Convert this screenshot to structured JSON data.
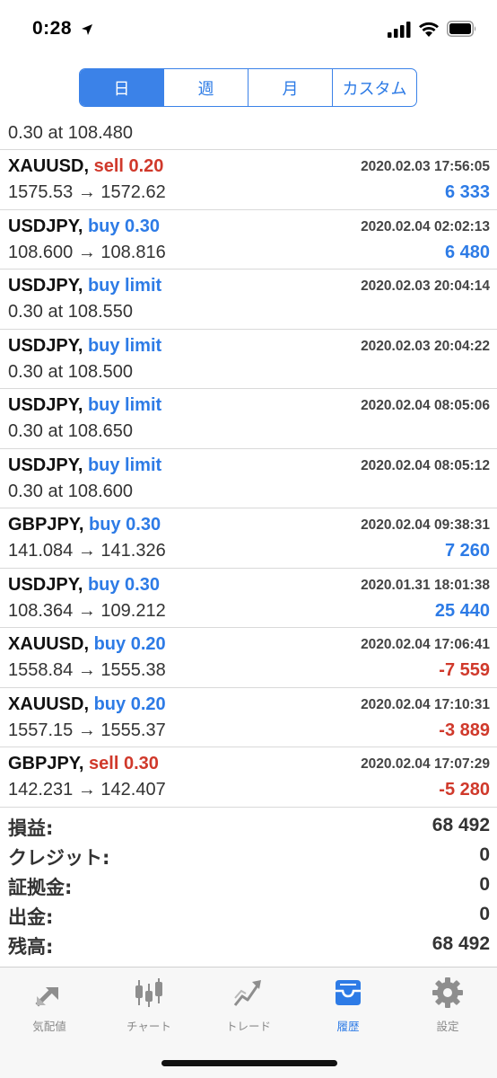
{
  "status": {
    "time": "0:28"
  },
  "segments": [
    "日",
    "週",
    "月",
    "カスタム"
  ],
  "partial_row": {
    "line2": "0.30 at 108.480"
  },
  "rows": [
    {
      "symbol": "XAUUSD,",
      "side": "sell 0.20",
      "date": "2020.02.03 17:56:05",
      "line2": "1575.53 → 1572.62",
      "profit": "6 333"
    },
    {
      "symbol": "USDJPY,",
      "side": "buy 0.30",
      "date": "2020.02.04 02:02:13",
      "line2": "108.600 → 108.816",
      "profit": "6 480"
    },
    {
      "symbol": "USDJPY,",
      "side": "buy limit",
      "date": "2020.02.03 20:04:14",
      "line2": "0.30 at 108.550",
      "profit": ""
    },
    {
      "symbol": "USDJPY,",
      "side": "buy limit",
      "date": "2020.02.03 20:04:22",
      "line2": "0.30 at 108.500",
      "profit": ""
    },
    {
      "symbol": "USDJPY,",
      "side": "buy limit",
      "date": "2020.02.04 08:05:06",
      "line2": "0.30 at 108.650",
      "profit": ""
    },
    {
      "symbol": "USDJPY,",
      "side": "buy limit",
      "date": "2020.02.04 08:05:12",
      "line2": "0.30 at 108.600",
      "profit": ""
    },
    {
      "symbol": "GBPJPY,",
      "side": "buy 0.30",
      "date": "2020.02.04 09:38:31",
      "line2": "141.084 → 141.326",
      "profit": "7 260"
    },
    {
      "symbol": "USDJPY,",
      "side": "buy 0.30",
      "date": "2020.01.31 18:01:38",
      "line2": "108.364 → 109.212",
      "profit": "25 440"
    },
    {
      "symbol": "XAUUSD,",
      "side": "buy 0.20",
      "date": "2020.02.04 17:06:41",
      "line2": "1558.84 → 1555.38",
      "profit": "-7 559"
    },
    {
      "symbol": "XAUUSD,",
      "side": "buy 0.20",
      "date": "2020.02.04 17:10:31",
      "line2": "1557.15 → 1555.37",
      "profit": "-3 889"
    },
    {
      "symbol": "GBPJPY,",
      "side": "sell 0.30",
      "date": "2020.02.04 17:07:29",
      "line2": "142.231 → 142.407",
      "profit": "-5 280"
    }
  ],
  "summary": [
    {
      "label": "損益:",
      "value": "68 492"
    },
    {
      "label": "クレジット:",
      "value": "0"
    },
    {
      "label": "証拠金:",
      "value": "0"
    },
    {
      "label": "出金:",
      "value": "0"
    },
    {
      "label": "残高:",
      "value": "68 492"
    }
  ],
  "tabs": [
    {
      "label": "気配値",
      "icon": "quotes-icon"
    },
    {
      "label": "チャート",
      "icon": "chart-icon"
    },
    {
      "label": "トレード",
      "icon": "trade-icon"
    },
    {
      "label": "履歴",
      "icon": "history-icon"
    },
    {
      "label": "設定",
      "icon": "settings-icon"
    }
  ],
  "colors": {
    "accent": "#2d7be6",
    "sell": "#d0392b",
    "neutral": "#333333"
  }
}
